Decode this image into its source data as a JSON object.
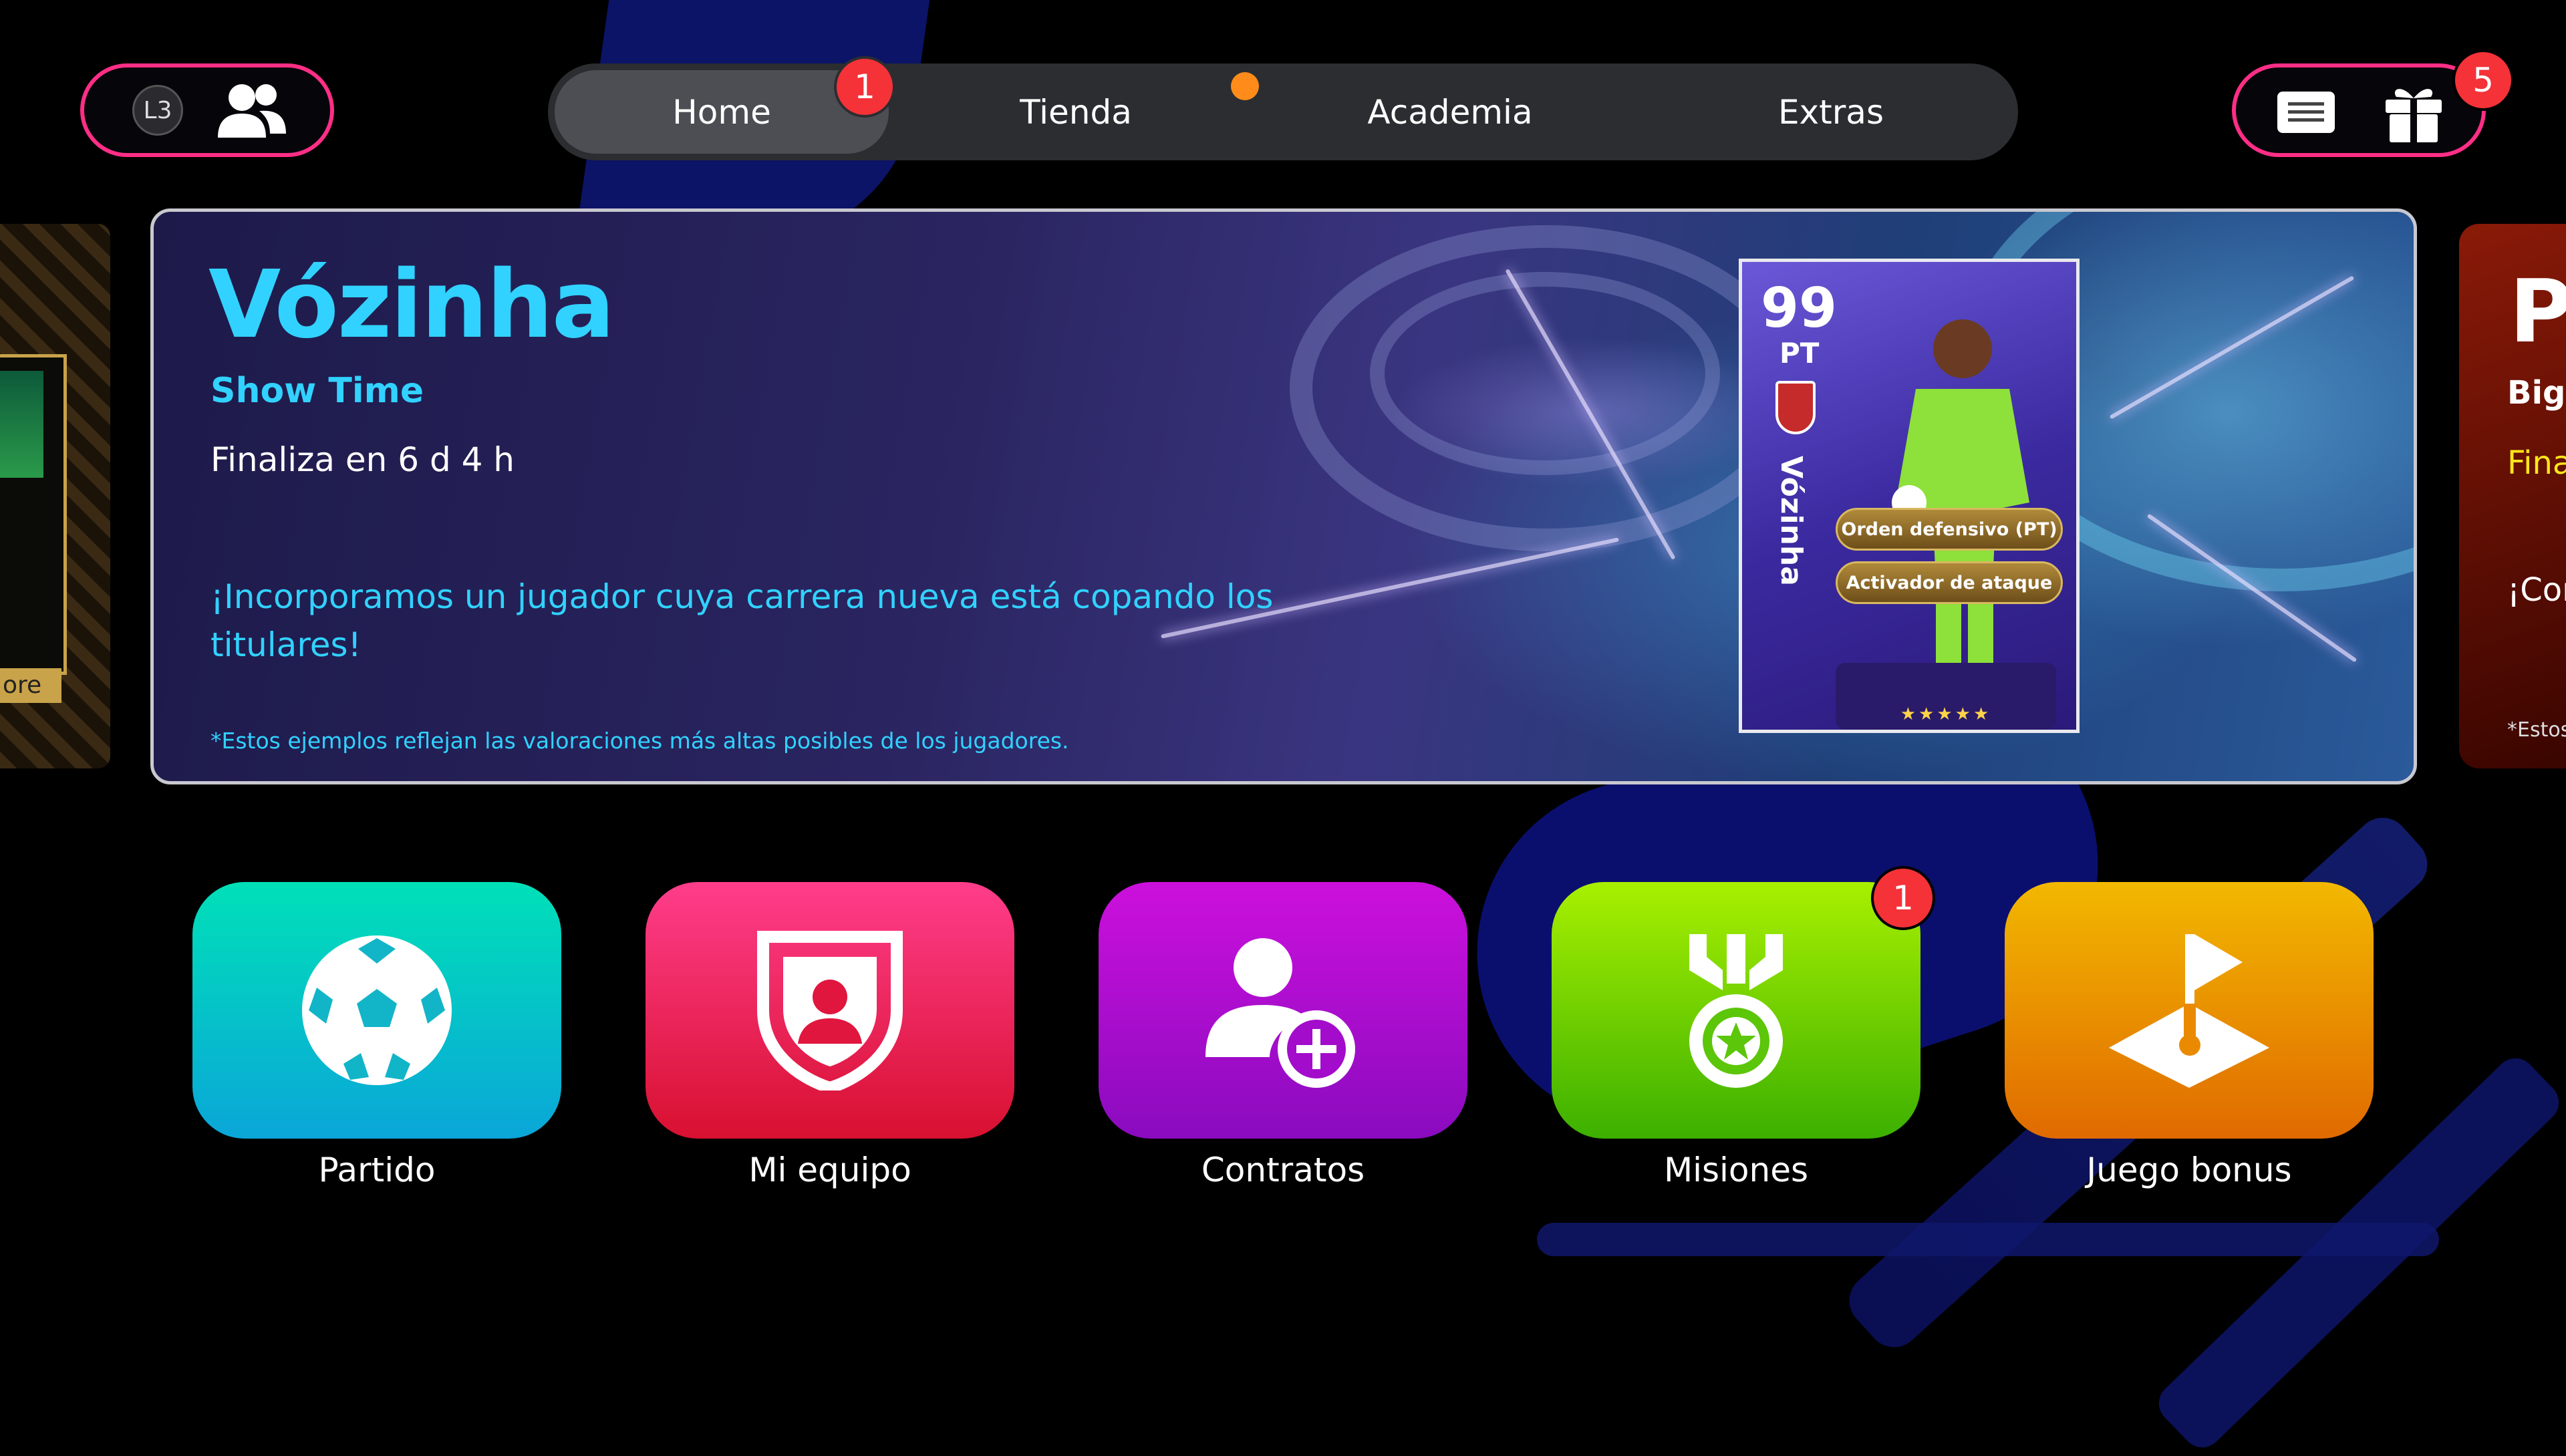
{
  "top_left": {
    "l3_label": "L3",
    "friends_icon": "friends-icon"
  },
  "nav": {
    "tabs": [
      {
        "label": "Home",
        "active": true,
        "badge": "1"
      },
      {
        "label": "Tienda",
        "active": false,
        "dot": true
      },
      {
        "label": "Academia",
        "active": false
      },
      {
        "label": "Extras",
        "active": false
      }
    ]
  },
  "top_right": {
    "news_icon": "news-icon",
    "gift_icon": "gift-icon",
    "gift_badge": "5"
  },
  "banner": {
    "title": "Vózinha",
    "subtitle": "Show Time",
    "ends": "Finaliza en 6 d 4 h",
    "description": "¡Incorporamos un jugador cuya carrera nueva está copando los titulares!",
    "note": "*Estos ejemplos reflejan las valoraciones más altas posibles de los jugadores.",
    "card": {
      "rating": "99",
      "position": "PT",
      "name": "Vózinha",
      "skills": [
        "Orden defensivo (PT)",
        "Activador de ataque"
      ],
      "stars": "★★★★★"
    }
  },
  "side_left": {
    "label": "ore"
  },
  "side_right": {
    "title": "Pl",
    "subtitle": "Big",
    "ends": "Fina",
    "desc": "¡Cor",
    "note": "*Estos"
  },
  "tiles": [
    {
      "label": "Partido",
      "icon": "soccer-ball-icon"
    },
    {
      "label": "Mi equipo",
      "icon": "team-shield-icon"
    },
    {
      "label": "Contratos",
      "icon": "add-player-icon"
    },
    {
      "label": "Misiones",
      "icon": "medal-icon",
      "badge": "1"
    },
    {
      "label": "Juego bonus",
      "icon": "flag-bonus-icon"
    }
  ],
  "colors": {
    "accent_pink": "#ff2e86",
    "badge_red": "#f43238",
    "title_cyan": "#31d2ff"
  }
}
